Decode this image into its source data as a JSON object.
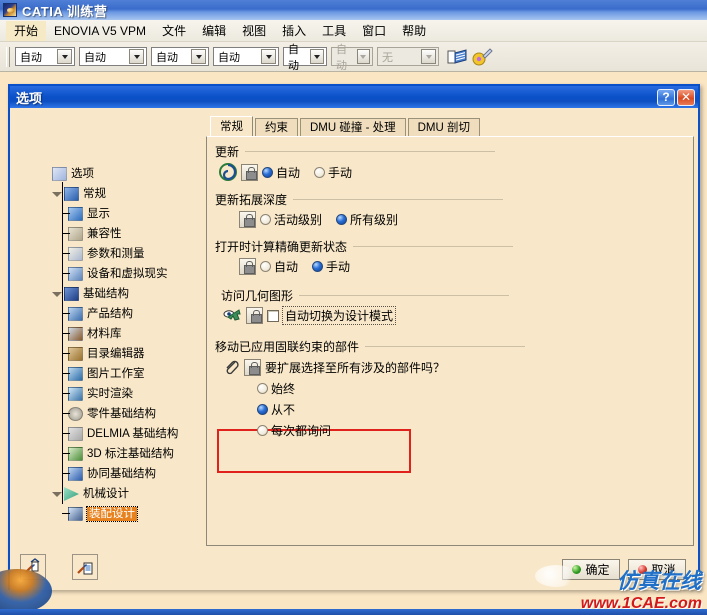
{
  "app": {
    "title": "CATIA 训练营",
    "icon": "catia-logo-icon",
    "menus": [
      "开始",
      "ENOVIA V5 VPM",
      "文件",
      "编辑",
      "视图",
      "插入",
      "工具",
      "窗口",
      "帮助"
    ],
    "toolbar": {
      "combos": [
        {
          "value": "自动",
          "disabled": false
        },
        {
          "value": "自动",
          "disabled": false
        },
        {
          "value": "自动",
          "disabled": false
        },
        {
          "value": "自动",
          "disabled": false
        },
        {
          "value": "自动",
          "disabled": false
        },
        {
          "value": "自动",
          "disabled": true
        },
        {
          "value": "无",
          "disabled": true
        }
      ],
      "icons": [
        "apply-material-icon",
        "paint-palette-icon"
      ]
    }
  },
  "dialog": {
    "title": "选项",
    "help_label": "?",
    "close_label": "✕",
    "background_watermark": "1CAE.COM",
    "tree": [
      {
        "label": "选项",
        "level": 0,
        "icon": "options-root-icon",
        "expander": "",
        "selected": false
      },
      {
        "label": "常规",
        "level": 1,
        "icon": "general-icon",
        "expander": "minus",
        "selected": false
      },
      {
        "label": "显示",
        "level": 2,
        "icon": "display-icon",
        "expander": "",
        "selected": false
      },
      {
        "label": "兼容性",
        "level": 2,
        "icon": "compatibility-icon",
        "expander": "",
        "selected": false
      },
      {
        "label": "参数和测量",
        "level": 2,
        "icon": "parameters-measure-icon",
        "expander": "",
        "selected": false
      },
      {
        "label": "设备和虚拟现实",
        "level": 2,
        "icon": "devices-vr-icon",
        "expander": "",
        "selected": false
      },
      {
        "label": "基础结构",
        "level": 1,
        "icon": "infrastructure-icon",
        "expander": "minus",
        "selected": false
      },
      {
        "label": "产品结构",
        "level": 2,
        "icon": "product-structure-icon",
        "expander": "",
        "selected": false
      },
      {
        "label": "材料库",
        "level": 2,
        "icon": "material-library-icon",
        "expander": "",
        "selected": false
      },
      {
        "label": "目录编辑器",
        "level": 2,
        "icon": "catalog-editor-icon",
        "expander": "",
        "selected": false
      },
      {
        "label": "图片工作室",
        "level": 2,
        "icon": "photo-studio-icon",
        "expander": "",
        "selected": false
      },
      {
        "label": "实时渲染",
        "level": 2,
        "icon": "realtime-render-icon",
        "expander": "",
        "selected": false
      },
      {
        "label": "零件基础结构",
        "level": 2,
        "icon": "part-infrastructure-icon",
        "expander": "",
        "selected": false
      },
      {
        "label": "DELMIA 基础结构",
        "level": 2,
        "icon": "delmia-infrastructure-icon",
        "expander": "",
        "selected": false
      },
      {
        "label": "3D 标注基础结构",
        "level": 2,
        "icon": "3d-annotation-icon",
        "expander": "",
        "selected": false
      },
      {
        "label": "协同基础结构",
        "level": 2,
        "icon": "collaborative-icon",
        "expander": "",
        "selected": false
      },
      {
        "label": "机械设计",
        "level": 1,
        "icon": "mechanical-design-icon",
        "expander": "minus",
        "selected": false
      },
      {
        "label": "装配设计",
        "level": 2,
        "icon": "assembly-design-icon",
        "expander": "",
        "selected": true
      }
    ],
    "scrollbar": {
      "up": "▲",
      "down": "▼"
    },
    "tabs": [
      {
        "label": "常规",
        "active": true
      },
      {
        "label": "约束",
        "active": false
      },
      {
        "label": "DMU 碰撞 - 处理",
        "active": false
      },
      {
        "label": "DMU 剖切",
        "active": false
      }
    ],
    "groups": {
      "update": {
        "title": "更新",
        "icon": "update-swirl-icon",
        "lock": "lock-icon",
        "options": [
          {
            "label": "自动",
            "selected": true
          },
          {
            "label": "手动",
            "selected": false
          }
        ]
      },
      "update_depth": {
        "title": "更新拓展深度",
        "lock": "lock-icon",
        "options": [
          {
            "label": "活动级别",
            "selected": false
          },
          {
            "label": "所有级别",
            "selected": true
          }
        ]
      },
      "compute_on_open": {
        "title": "打开时计算精确更新状态",
        "lock": "lock-icon",
        "options": [
          {
            "label": "自动",
            "selected": false
          },
          {
            "label": "手动",
            "selected": true
          }
        ]
      },
      "access_geometry": {
        "title": "访问几何图形",
        "icon": "access-geometry-eye-icon",
        "lock": "lock-icon",
        "checkbox": {
          "label": "自动切换为设计模式",
          "checked": false,
          "focused": true
        },
        "highlight_color": "#e1211c"
      },
      "move_fixed": {
        "title": "移动已应用固联约束的部件",
        "icon": "paperclip-icon",
        "lock": "lock-icon",
        "question": "要扩展选择至所有涉及的部件吗？",
        "options": [
          {
            "label": "始终",
            "selected": false
          },
          {
            "label": "从不",
            "selected": true
          },
          {
            "label": "每次都询问",
            "selected": false
          }
        ]
      }
    },
    "bottom_icons": [
      "home-settings-icon",
      "document-settings-icon"
    ],
    "actions": [
      {
        "label": "确定",
        "led": "green"
      },
      {
        "label": "取消",
        "led": "red"
      }
    ]
  },
  "watermark": {
    "line1_blue_a": "仿",
    "line1_red": "真",
    "line1_blue_b": "在线",
    "line1_full": "仿真在线",
    "line2": "www.1CAE.com"
  }
}
